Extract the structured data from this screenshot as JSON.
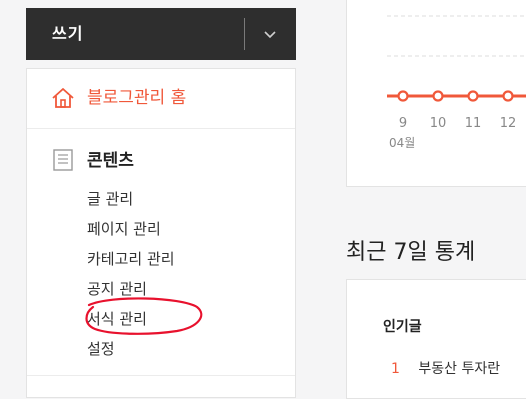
{
  "write": {
    "label": "쓰기"
  },
  "sidebar": {
    "home_label": "블로그관리 홈",
    "content_section": {
      "title": "콘텐츠",
      "items": [
        {
          "label": "글 관리"
        },
        {
          "label": "페이지 관리"
        },
        {
          "label": "카테고리 관리"
        },
        {
          "label": "공지 관리"
        },
        {
          "label": "서식 관리"
        },
        {
          "label": "설정"
        }
      ]
    }
  },
  "colors": {
    "accent": "#f0583a",
    "annotation": "#e8112d",
    "dark_button": "#2e2e2e"
  },
  "chart_data": {
    "type": "line",
    "categories": [
      "9",
      "10",
      "11",
      "12"
    ],
    "month_label": "04월",
    "series": [
      {
        "values": [
          0,
          0,
          0,
          0
        ]
      }
    ],
    "grid": true
  },
  "recent": {
    "title": "최근 7일 통계"
  },
  "popular": {
    "title": "인기글",
    "items": [
      {
        "rank": "1",
        "title": "부동산 투자란"
      }
    ]
  }
}
